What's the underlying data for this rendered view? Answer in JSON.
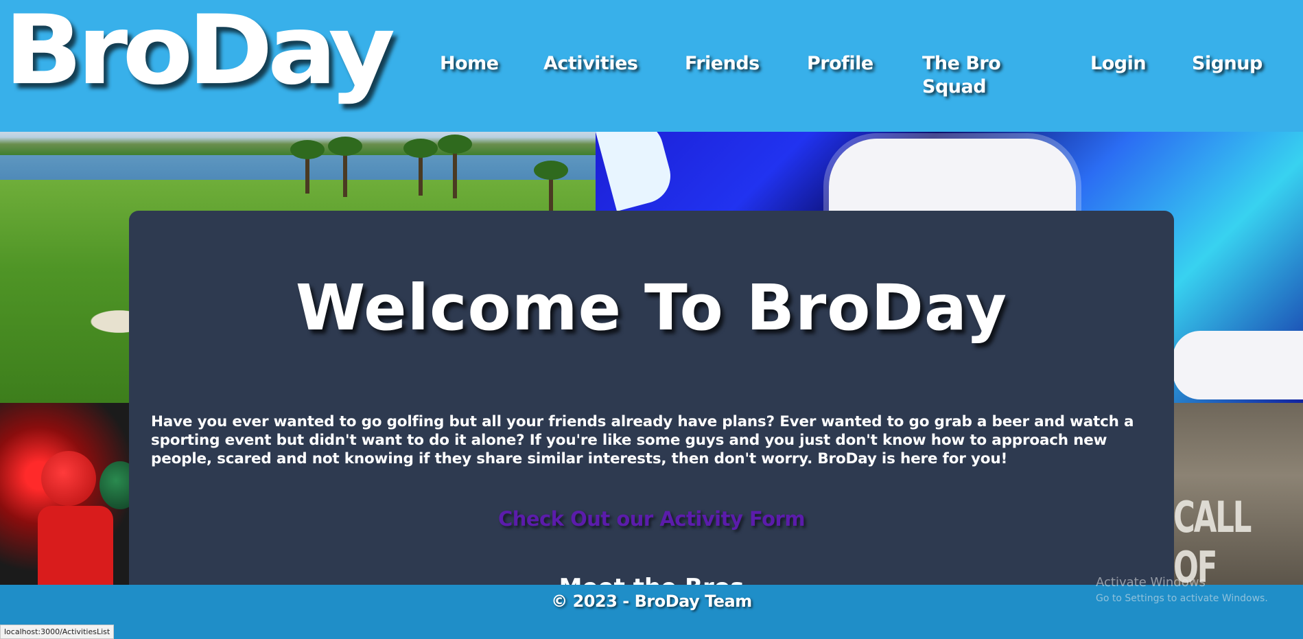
{
  "header": {
    "logo": "BroDay",
    "nav": {
      "home": "Home",
      "activities": "Activities",
      "friends": "Friends",
      "profile": "Profile",
      "bro_squad_line1": "The Bro",
      "bro_squad_line2": "Squad",
      "login": "Login",
      "signup": "Signup"
    }
  },
  "background": {
    "cod_logo": "CALL OF DUTY"
  },
  "main": {
    "title": "Welcome To BroDay",
    "intro": "Have you ever wanted to go golfing but all your friends already have plans? Ever wanted to go grab a beer and watch a sporting event but didn't want to do it alone? If you're like some guys and you just don't know how to approach new people, scared and not knowing if they share similar interests, then don't worry. BroDay is here for you!",
    "activity_link": "Check Out our Activity Form",
    "next_heading_partial": "Meet the Bros"
  },
  "footer": {
    "copyright": "© 2023 - BroDay Team"
  },
  "os_overlay": {
    "activate_title": "Activate Windows",
    "activate_sub": "Go to Settings to activate Windows."
  },
  "status_bar": {
    "url": "localhost:3000/ActivitiesList"
  },
  "colors": {
    "header_bg": "#38b0ea",
    "card_bg": "#2e3a50",
    "footer_bg": "#1f8ec8",
    "link": "#5b1cab"
  }
}
